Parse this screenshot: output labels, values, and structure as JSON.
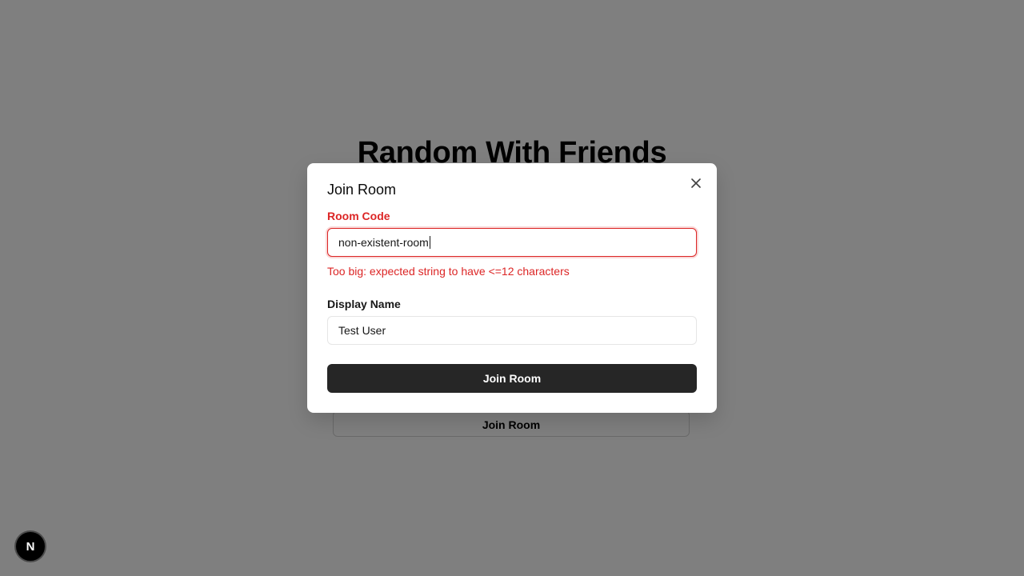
{
  "background": {
    "title": "Random With Friends",
    "join_button_label": "Join Room"
  },
  "dialog": {
    "title": "Join Room",
    "close_icon": "close-icon",
    "room_code": {
      "label": "Room Code",
      "value": "non-existent-room",
      "error": "Too big: expected string to have <=12 characters"
    },
    "display_name": {
      "label": "Display Name",
      "value": "Test User"
    },
    "submit_label": "Join Room"
  },
  "dev_badge": {
    "label": "N"
  },
  "colors": {
    "error": "#dc2626",
    "primary_button": "#262626",
    "overlay": "rgba(0,0,0,0.5)"
  }
}
